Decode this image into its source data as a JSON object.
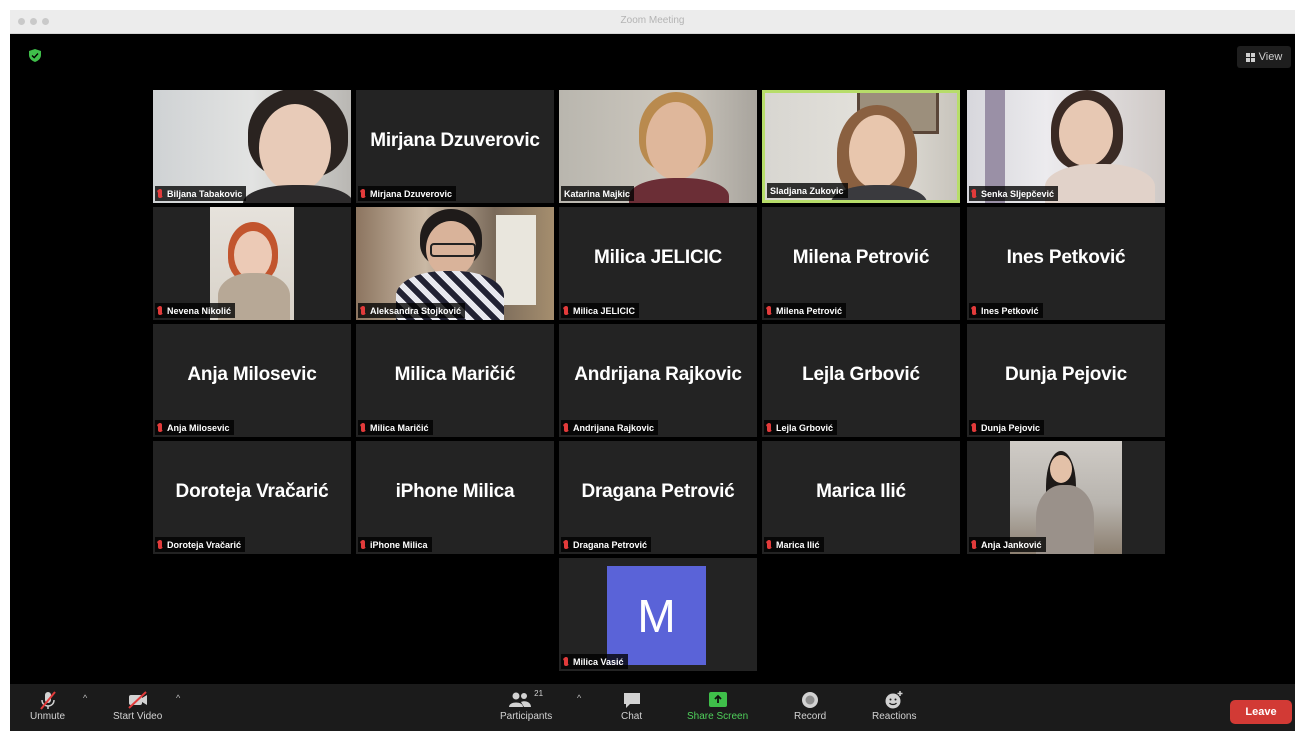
{
  "window": {
    "title": "Zoom Meeting"
  },
  "header": {
    "view_label": "View"
  },
  "tiles": [
    {
      "name": "Biljana Tabakovic",
      "display": "",
      "video": true
    },
    {
      "name": "Mirjana Dzuverovic",
      "display": "Mirjana Dzuverovic",
      "video": false
    },
    {
      "name": "Katarina Majkic",
      "display": "",
      "video": true
    },
    {
      "name": "Sladjana Zukovic",
      "display": "",
      "video": true,
      "active_speaker": true
    },
    {
      "name": "Senka Sljepčević",
      "display": "",
      "video": true
    },
    {
      "name": "Nevena Nikolić",
      "display": "",
      "video": true
    },
    {
      "name": "Aleksandra Stojković",
      "display": "",
      "video": true
    },
    {
      "name": "Milica JELICIC",
      "display": "Milica JELICIC",
      "video": false
    },
    {
      "name": "Milena Petrović",
      "display": "Milena Petrović",
      "video": false
    },
    {
      "name": "Ines Petković",
      "display": "Ines Petković",
      "video": false
    },
    {
      "name": "Anja Milosevic",
      "display": "Anja Milosevic",
      "video": false
    },
    {
      "name": "Milica Maričić",
      "display": "Milica Maričić",
      "video": false
    },
    {
      "name": "Andrijana Rajkovic",
      "display": "Andrijana Rajkovic",
      "video": false
    },
    {
      "name": "Lejla Grbović",
      "display": "Lejla Grbović",
      "video": false
    },
    {
      "name": "Dunja Pejovic",
      "display": "Dunja Pejovic",
      "video": false
    },
    {
      "name": "Doroteja Vračarić",
      "display": "Doroteja Vračarić",
      "video": false
    },
    {
      "name": "iPhone Milica",
      "display": "iPhone Milica",
      "video": false
    },
    {
      "name": "Dragana Petrović",
      "display": "Dragana Petrović",
      "video": false
    },
    {
      "name": "Marica Ilić",
      "display": "Marica Ilić",
      "video": false
    },
    {
      "name": "Anja Janković",
      "display": "",
      "video": true
    },
    {
      "name": "Milica Vasić",
      "display": "",
      "video": false,
      "avatar_letter": "M"
    }
  ],
  "toolbar": {
    "unmute_label": "Unmute",
    "start_video_label": "Start Video",
    "participants_label": "Participants",
    "participants_count": "21",
    "chat_label": "Chat",
    "share_screen_label": "Share Screen",
    "record_label": "Record",
    "reactions_label": "Reactions",
    "leave_label": "Leave"
  },
  "colors": {
    "active_speaker_border": "#b7dd6a",
    "mic_muted": "#e23b3b",
    "share_screen": "#4fd05b",
    "leave_button": "#d23a35",
    "avatar_bg": "#5a63d8"
  }
}
